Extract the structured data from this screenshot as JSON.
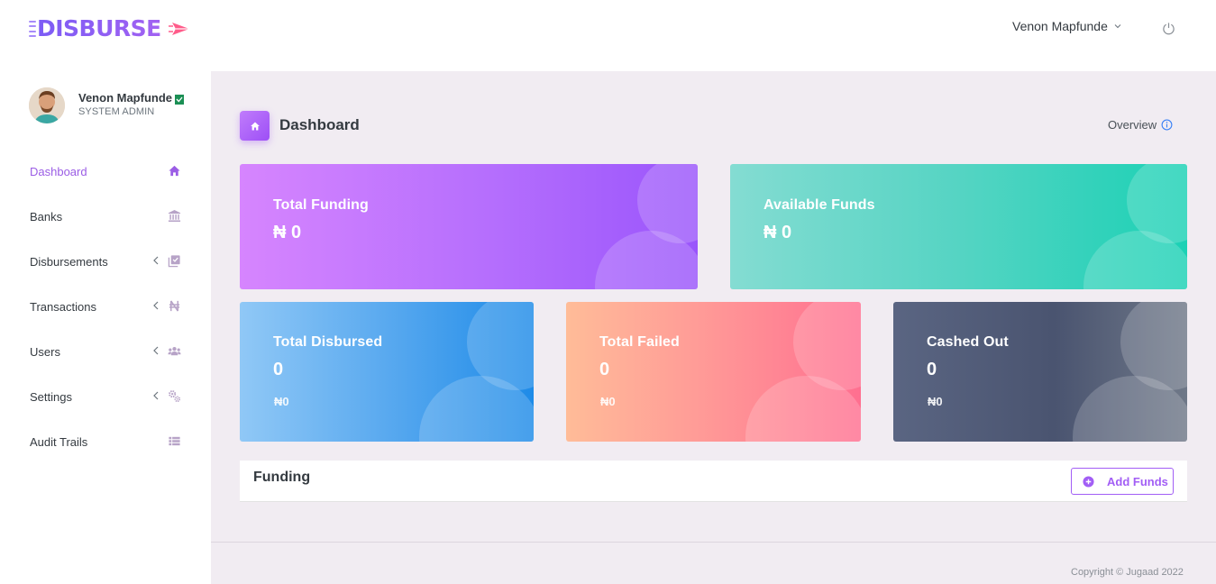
{
  "header": {
    "logo_text": "DISBURSE",
    "user_name": "Venon Mapfunde"
  },
  "sidebar": {
    "profile": {
      "name": "Venon Mapfunde",
      "role": "SYSTEM ADMIN"
    },
    "items": [
      {
        "label": "Dashboard",
        "icon": "home-icon",
        "active": true
      },
      {
        "label": "Banks",
        "icon": "bank-icon"
      },
      {
        "label": "Disbursements",
        "icon": "check-box-icon",
        "has_submenu": true
      },
      {
        "label": "Transactions",
        "icon": "naira-icon",
        "has_submenu": true
      },
      {
        "label": "Users",
        "icon": "users-icon",
        "has_submenu": true
      },
      {
        "label": "Settings",
        "icon": "cogs-icon",
        "has_submenu": true
      },
      {
        "label": "Audit Trails",
        "icon": "list-icon"
      }
    ]
  },
  "main": {
    "page_title": "Dashboard",
    "overview_label": "Overview",
    "cards": {
      "total_funding": {
        "label": "Total Funding",
        "value": "₦ 0"
      },
      "available_funds": {
        "label": "Available Funds",
        "value": "₦ 0"
      },
      "total_disbursed": {
        "label": "Total Disbursed",
        "value": "0",
        "sub": "₦0"
      },
      "total_failed": {
        "label": "Total Failed",
        "value": "0",
        "sub": "₦0"
      },
      "cashed_out": {
        "label": "Cashed Out",
        "value": "0",
        "sub": "₦0"
      }
    },
    "funding": {
      "title": "Funding",
      "add_button": "Add Funds"
    }
  },
  "footer": {
    "copyright": "Copyright © Jugaad 2022"
  },
  "colors": {
    "accent": "#9b5de5",
    "sidebar_icon": "#b7a3c7",
    "background": "#f1ecf2"
  }
}
